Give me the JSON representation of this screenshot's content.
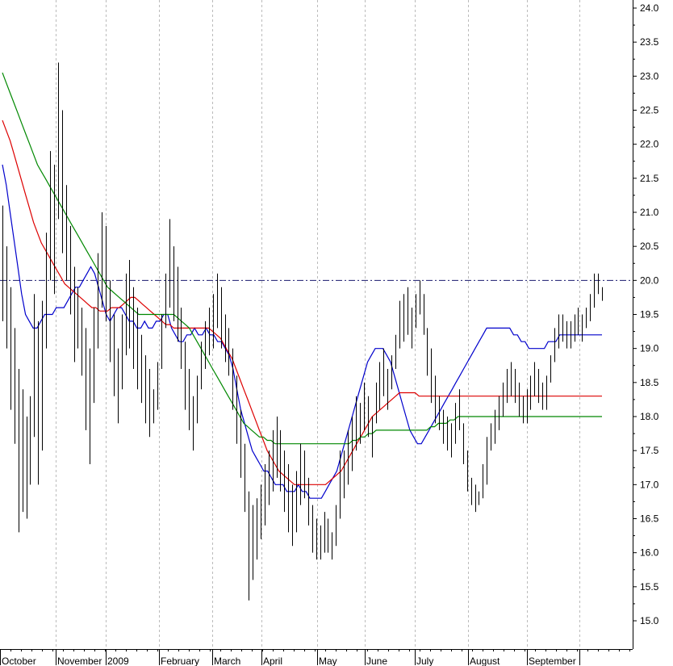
{
  "chart_data": {
    "type": "ohlc",
    "x_labels": [
      "October",
      "November",
      "2009",
      "February",
      "March",
      "April",
      "May",
      "June",
      "July",
      "August",
      "September"
    ],
    "y_ticks": [
      "24.0",
      "23.5",
      "23.0",
      "22.5",
      "22.0",
      "21.5",
      "21.0",
      "20.5",
      "20.0",
      "19.5",
      "19.0",
      "18.5",
      "18.0",
      "17.5",
      "17.0",
      "16.5",
      "16.0",
      "15.5",
      "15.0"
    ],
    "ylim": [
      14.6,
      24.1
    ],
    "reference_line": 20.0,
    "grid": "vertical dashed at month starts",
    "colors": {
      "bars": "#000000",
      "ma_short": "#0000cc",
      "ma_mid": "#dd0000",
      "ma_long": "#008800",
      "reference_line": "#1a1a6e",
      "grid": "#bbbbbb"
    },
    "bars": [
      {
        "h": 21.1,
        "l": 19.4
      },
      {
        "h": 20.5,
        "l": 19.0
      },
      {
        "h": 19.9,
        "l": 18.1
      },
      {
        "h": 19.3,
        "l": 17.6
      },
      {
        "h": 18.7,
        "l": 16.3
      },
      {
        "h": 18.4,
        "l": 16.6
      },
      {
        "h": 18.0,
        "l": 16.5
      },
      {
        "h": 18.3,
        "l": 17.0
      },
      {
        "h": 19.8,
        "l": 17.7
      },
      {
        "h": 19.4,
        "l": 17.0
      },
      {
        "h": 19.7,
        "l": 17.5
      },
      {
        "h": 20.7,
        "l": 19.0
      },
      {
        "h": 21.9,
        "l": 20.0
      },
      {
        "h": 21.7,
        "l": 19.8
      },
      {
        "h": 23.2,
        "l": 20.9
      },
      {
        "h": 22.5,
        "l": 20.4
      },
      {
        "h": 21.4,
        "l": 20.0
      },
      {
        "h": 20.8,
        "l": 19.5
      },
      {
        "h": 20.2,
        "l": 18.8
      },
      {
        "h": 19.9,
        "l": 19.0
      },
      {
        "h": 19.6,
        "l": 18.6
      },
      {
        "h": 19.3,
        "l": 17.8
      },
      {
        "h": 19.0,
        "l": 17.3
      },
      {
        "h": 19.6,
        "l": 18.2
      },
      {
        "h": 20.4,
        "l": 19.0
      },
      {
        "h": 21.0,
        "l": 19.6
      },
      {
        "h": 20.8,
        "l": 19.4
      },
      {
        "h": 20.0,
        "l": 18.8
      },
      {
        "h": 19.5,
        "l": 18.3
      },
      {
        "h": 19.0,
        "l": 17.9
      },
      {
        "h": 19.5,
        "l": 18.4
      },
      {
        "h": 20.1,
        "l": 18.9
      },
      {
        "h": 20.3,
        "l": 19.0
      },
      {
        "h": 19.9,
        "l": 18.7
      },
      {
        "h": 19.6,
        "l": 18.4
      },
      {
        "h": 19.2,
        "l": 18.2
      },
      {
        "h": 18.9,
        "l": 17.9
      },
      {
        "h": 18.7,
        "l": 17.7
      },
      {
        "h": 18.4,
        "l": 17.9
      },
      {
        "h": 18.8,
        "l": 18.1
      },
      {
        "h": 19.5,
        "l": 18.7
      },
      {
        "h": 20.1,
        "l": 19.3
      },
      {
        "h": 20.9,
        "l": 19.6
      },
      {
        "h": 20.5,
        "l": 19.4
      },
      {
        "h": 20.2,
        "l": 19.1
      },
      {
        "h": 19.6,
        "l": 18.7
      },
      {
        "h": 19.1,
        "l": 18.1
      },
      {
        "h": 18.7,
        "l": 17.8
      },
      {
        "h": 18.3,
        "l": 17.5
      },
      {
        "h": 18.6,
        "l": 17.9
      },
      {
        "h": 19.1,
        "l": 18.4
      },
      {
        "h": 19.4,
        "l": 18.7
      },
      {
        "h": 19.6,
        "l": 18.9
      },
      {
        "h": 19.8,
        "l": 19.0
      },
      {
        "h": 20.1,
        "l": 19.3
      },
      {
        "h": 19.9,
        "l": 19.0
      },
      {
        "h": 19.5,
        "l": 18.8
      },
      {
        "h": 19.3,
        "l": 18.6
      },
      {
        "h": 19.0,
        "l": 18.1
      },
      {
        "h": 18.6,
        "l": 17.6
      },
      {
        "h": 18.1,
        "l": 17.1
      },
      {
        "h": 17.6,
        "l": 16.6
      },
      {
        "h": 16.9,
        "l": 15.3
      },
      {
        "h": 16.7,
        "l": 15.6
      },
      {
        "h": 16.8,
        "l": 15.9
      },
      {
        "h": 17.0,
        "l": 16.2
      },
      {
        "h": 17.3,
        "l": 16.4
      },
      {
        "h": 17.5,
        "l": 16.7
      },
      {
        "h": 17.8,
        "l": 16.9
      },
      {
        "h": 18.0,
        "l": 17.1
      },
      {
        "h": 17.8,
        "l": 16.9
      },
      {
        "h": 17.5,
        "l": 16.6
      },
      {
        "h": 17.3,
        "l": 16.3
      },
      {
        "h": 17.0,
        "l": 16.1
      },
      {
        "h": 17.2,
        "l": 16.3
      },
      {
        "h": 17.6,
        "l": 16.7
      },
      {
        "h": 17.5,
        "l": 16.8
      },
      {
        "h": 17.1,
        "l": 16.4
      },
      {
        "h": 16.7,
        "l": 16.0
      },
      {
        "h": 16.5,
        "l": 15.9
      },
      {
        "h": 16.4,
        "l": 15.9
      },
      {
        "h": 16.6,
        "l": 16.0
      },
      {
        "h": 16.5,
        "l": 16.0
      },
      {
        "h": 16.3,
        "l": 15.9
      },
      {
        "h": 16.7,
        "l": 16.1
      },
      {
        "h": 17.5,
        "l": 16.5
      },
      {
        "h": 17.5,
        "l": 16.8
      },
      {
        "h": 17.8,
        "l": 17.0
      },
      {
        "h": 18.0,
        "l": 17.2
      },
      {
        "h": 18.3,
        "l": 17.5
      },
      {
        "h": 18.2,
        "l": 17.6
      },
      {
        "h": 18.5,
        "l": 17.8
      },
      {
        "h": 18.3,
        "l": 17.7
      },
      {
        "h": 18.0,
        "l": 17.4
      },
      {
        "h": 18.5,
        "l": 17.9
      },
      {
        "h": 18.8,
        "l": 18.1
      },
      {
        "h": 19.0,
        "l": 18.3
      },
      {
        "h": 18.7,
        "l": 18.1
      },
      {
        "h": 18.9,
        "l": 18.4
      },
      {
        "h": 19.2,
        "l": 18.7
      },
      {
        "h": 19.7,
        "l": 19.0
      },
      {
        "h": 19.8,
        "l": 19.1
      },
      {
        "h": 19.9,
        "l": 19.2
      },
      {
        "h": 19.6,
        "l": 19.0
      },
      {
        "h": 19.8,
        "l": 19.3
      },
      {
        "h": 20.0,
        "l": 19.5
      },
      {
        "h": 19.8,
        "l": 19.2
      },
      {
        "h": 19.3,
        "l": 18.6
      },
      {
        "h": 19.0,
        "l": 18.2
      },
      {
        "h": 18.6,
        "l": 17.9
      },
      {
        "h": 18.3,
        "l": 17.8
      },
      {
        "h": 18.1,
        "l": 17.6
      },
      {
        "h": 18.0,
        "l": 17.5
      },
      {
        "h": 17.9,
        "l": 17.4
      },
      {
        "h": 18.2,
        "l": 17.6
      },
      {
        "h": 18.4,
        "l": 17.8
      },
      {
        "h": 17.9,
        "l": 17.3
      },
      {
        "h": 17.5,
        "l": 16.9
      },
      {
        "h": 17.1,
        "l": 16.7
      },
      {
        "h": 17.0,
        "l": 16.6
      },
      {
        "h": 16.9,
        "l": 16.7
      },
      {
        "h": 17.3,
        "l": 16.8
      },
      {
        "h": 17.7,
        "l": 17.0
      },
      {
        "h": 17.9,
        "l": 17.5
      },
      {
        "h": 18.1,
        "l": 17.6
      },
      {
        "h": 18.3,
        "l": 17.8
      },
      {
        "h": 18.5,
        "l": 18.0
      },
      {
        "h": 18.7,
        "l": 18.2
      },
      {
        "h": 18.8,
        "l": 18.3
      },
      {
        "h": 18.7,
        "l": 18.2
      },
      {
        "h": 18.5,
        "l": 18.0
      },
      {
        "h": 18.3,
        "l": 17.9
      },
      {
        "h": 18.4,
        "l": 17.9
      },
      {
        "h": 18.6,
        "l": 18.1
      },
      {
        "h": 18.8,
        "l": 18.3
      },
      {
        "h": 18.7,
        "l": 18.2
      },
      {
        "h": 18.5,
        "l": 18.1
      },
      {
        "h": 18.6,
        "l": 18.1
      },
      {
        "h": 18.9,
        "l": 18.5
      },
      {
        "h": 19.3,
        "l": 18.8
      },
      {
        "h": 19.5,
        "l": 19.0
      },
      {
        "h": 19.5,
        "l": 19.1
      },
      {
        "h": 19.4,
        "l": 19.0
      },
      {
        "h": 19.4,
        "l": 19.0
      },
      {
        "h": 19.5,
        "l": 19.1
      },
      {
        "h": 19.6,
        "l": 19.2
      },
      {
        "h": 19.5,
        "l": 19.1
      },
      {
        "h": 19.6,
        "l": 19.3
      },
      {
        "h": 19.8,
        "l": 19.4
      },
      {
        "h": 20.1,
        "l": 19.6
      },
      {
        "h": 20.1,
        "l": 19.8
      },
      {
        "h": 19.9,
        "l": 19.7
      }
    ],
    "series": [
      {
        "values": [
          21.7,
          21.4,
          21.0,
          20.6,
          20.2,
          19.8,
          19.5,
          19.4,
          19.3,
          19.3,
          19.4,
          19.5,
          19.5,
          19.5,
          19.6,
          19.6,
          19.6,
          19.7,
          19.8,
          19.9,
          19.9,
          20.0,
          20.1,
          20.2,
          20.1,
          19.9,
          19.7,
          19.5,
          19.4,
          19.5,
          19.6,
          19.6,
          19.5,
          19.4,
          19.4,
          19.3,
          19.3,
          19.4,
          19.3,
          19.3,
          19.4,
          19.4,
          19.5,
          19.5,
          19.3,
          19.2,
          19.1,
          19.1,
          19.2,
          19.2,
          19.3,
          19.2,
          19.2,
          19.3,
          19.2,
          19.2,
          19.1,
          19.1,
          19.0,
          18.9,
          18.7,
          18.4,
          18.1,
          17.9,
          17.7,
          17.5,
          17.4,
          17.3,
          17.2,
          17.2,
          17.1,
          17.0,
          17.0,
          17.0,
          16.9,
          16.9,
          16.9,
          17.0,
          16.9,
          16.9,
          16.8,
          16.8,
          16.8,
          16.8,
          16.9,
          17.0,
          17.1,
          17.2,
          17.4,
          17.6,
          17.8,
          18.0,
          18.2,
          18.4,
          18.6,
          18.8,
          18.9,
          19.0,
          19.0,
          19.0,
          18.9,
          18.8,
          18.6,
          18.4,
          18.2,
          18.0,
          17.8,
          17.7,
          17.6,
          17.6,
          17.7,
          17.8,
          17.9,
          18.0,
          18.1,
          18.2,
          18.3,
          18.4,
          18.5,
          18.6,
          18.7,
          18.8,
          18.9,
          19.0,
          19.1,
          19.2,
          19.3,
          19.3,
          19.3,
          19.3,
          19.3,
          19.3,
          19.3,
          19.2,
          19.2,
          19.1,
          19.1,
          19.0,
          19.0,
          19.0,
          19.0,
          19.0,
          19.1,
          19.1,
          19.1,
          19.2,
          19.2,
          19.2,
          19.2,
          19.2,
          19.2,
          19.2,
          19.2,
          19.2,
          19.2,
          19.2,
          19.2
        ]
      },
      {
        "values": [
          22.35,
          22.2,
          22.05,
          21.85,
          21.65,
          21.45,
          21.25,
          21.05,
          20.85,
          20.7,
          20.55,
          20.45,
          20.35,
          20.25,
          20.15,
          20.05,
          19.95,
          19.9,
          19.85,
          19.8,
          19.75,
          19.7,
          19.65,
          19.6,
          19.6,
          19.55,
          19.55,
          19.55,
          19.6,
          19.6,
          19.6,
          19.65,
          19.7,
          19.75,
          19.75,
          19.7,
          19.65,
          19.6,
          19.55,
          19.5,
          19.45,
          19.4,
          19.35,
          19.35,
          19.3,
          19.3,
          19.3,
          19.3,
          19.3,
          19.3,
          19.3,
          19.3,
          19.3,
          19.3,
          19.25,
          19.2,
          19.15,
          19.05,
          18.95,
          18.85,
          18.7,
          18.55,
          18.4,
          18.25,
          18.1,
          17.95,
          17.8,
          17.65,
          17.5,
          17.4,
          17.3,
          17.2,
          17.15,
          17.1,
          17.05,
          17.0,
          17.0,
          17.0,
          17.0,
          17.0,
          17.0,
          17.0,
          17.0,
          17.0,
          17.05,
          17.1,
          17.15,
          17.2,
          17.3,
          17.4,
          17.5,
          17.6,
          17.7,
          17.8,
          17.9,
          18.0,
          18.05,
          18.1,
          18.15,
          18.2,
          18.25,
          18.3,
          18.35,
          18.35,
          18.35,
          18.35,
          18.35,
          18.3,
          18.3,
          18.3,
          18.3,
          18.3,
          18.3,
          18.3,
          18.3,
          18.3,
          18.3,
          18.3,
          18.3,
          18.3,
          18.3,
          18.3,
          18.3,
          18.3,
          18.3,
          18.3,
          18.3,
          18.3,
          18.3,
          18.3,
          18.3,
          18.3,
          18.3,
          18.3,
          18.3,
          18.3,
          18.3,
          18.3,
          18.3,
          18.3,
          18.3,
          18.3,
          18.3,
          18.3,
          18.3,
          18.3,
          18.3,
          18.3,
          18.3,
          18.3,
          18.3,
          18.3,
          18.3,
          18.3,
          18.3
        ]
      },
      {
        "values": [
          23.05,
          22.9,
          22.75,
          22.6,
          22.45,
          22.3,
          22.15,
          22.0,
          21.85,
          21.7,
          21.6,
          21.5,
          21.4,
          21.3,
          21.2,
          21.1,
          21.0,
          20.9,
          20.8,
          20.7,
          20.6,
          20.5,
          20.4,
          20.3,
          20.2,
          20.1,
          20.0,
          19.9,
          19.85,
          19.8,
          19.75,
          19.7,
          19.65,
          19.6,
          19.55,
          19.5,
          19.5,
          19.5,
          19.5,
          19.5,
          19.5,
          19.5,
          19.5,
          19.5,
          19.5,
          19.45,
          19.4,
          19.35,
          19.3,
          19.2,
          19.1,
          19.0,
          18.9,
          18.8,
          18.7,
          18.6,
          18.5,
          18.4,
          18.3,
          18.2,
          18.1,
          18.0,
          17.9,
          17.85,
          17.8,
          17.75,
          17.7,
          17.7,
          17.65,
          17.65,
          17.6,
          17.6,
          17.6,
          17.6,
          17.6,
          17.6,
          17.6,
          17.6,
          17.6,
          17.6,
          17.6,
          17.6,
          17.6,
          17.6,
          17.6,
          17.6,
          17.6,
          17.6,
          17.6,
          17.6,
          17.65,
          17.65,
          17.7,
          17.7,
          17.75,
          17.75,
          17.8,
          17.8,
          17.8,
          17.8,
          17.8,
          17.8,
          17.8,
          17.8,
          17.8,
          17.8,
          17.8,
          17.8,
          17.8,
          17.8,
          17.85,
          17.85,
          17.9,
          17.9,
          17.9,
          17.95,
          17.95,
          18.0,
          18.0,
          18.0,
          18.0,
          18.0,
          18.0,
          18.0,
          18.0,
          18.0,
          18.0,
          18.0,
          18.0,
          18.0,
          18.0,
          18.0,
          18.0,
          18.0,
          18.0,
          18.0,
          18.0,
          18.0,
          18.0,
          18.0,
          18.0,
          18.0,
          18.0,
          18.0,
          18.0,
          18.0,
          18.0,
          18.0,
          18.0,
          18.0,
          18.0,
          18.0,
          18.0,
          18.0,
          18.0
        ]
      }
    ]
  }
}
